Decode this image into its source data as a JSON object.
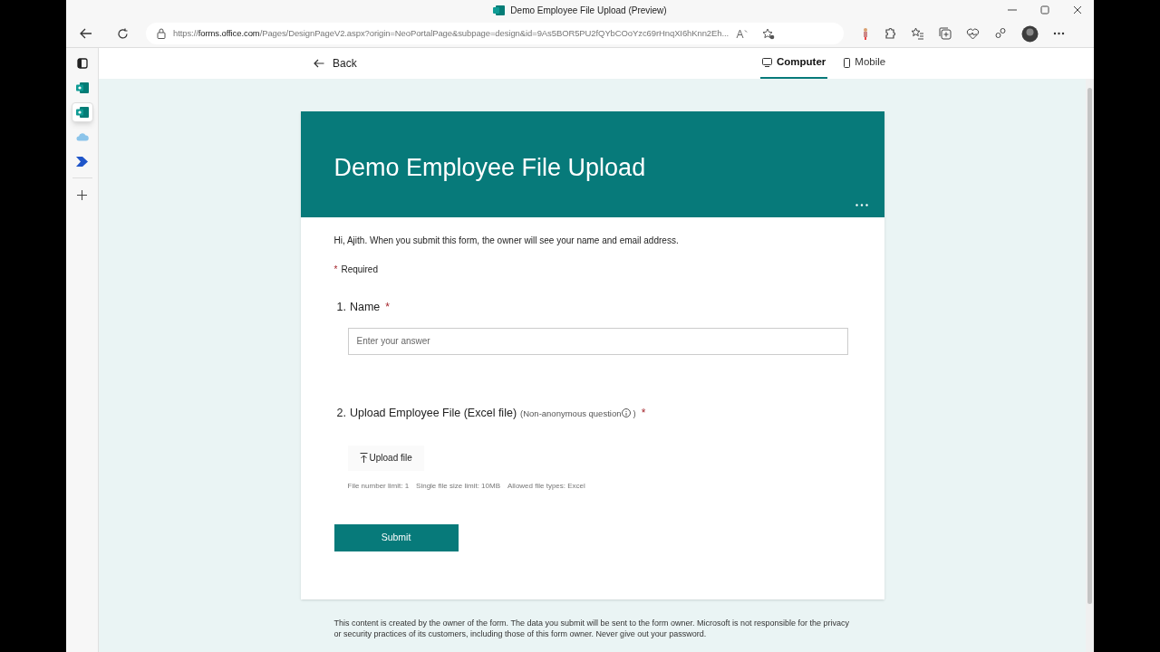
{
  "window": {
    "title": "Demo Employee File Upload (Preview)"
  },
  "address_bar": {
    "url_prefix": "https://",
    "url_host": "forms.office.com",
    "url_rest": "/Pages/DesignPageV2.aspx?origin=NeoPortalPage&subpage=design&id=9As5BOR5PU2fQYbCOoYzc69rHnqXI6hKnn2Eh..."
  },
  "sidebar": {
    "items": [
      {
        "kind": "tabs",
        "selected": false
      },
      {
        "kind": "forms",
        "selected": false
      },
      {
        "kind": "forms",
        "selected": true
      },
      {
        "kind": "cloud",
        "selected": false
      },
      {
        "kind": "automate",
        "selected": false
      },
      {
        "kind": "add",
        "selected": false
      }
    ]
  },
  "toolbar": {
    "back": "Back",
    "view_tabs": [
      {
        "label": "Computer",
        "kind": "computer",
        "selected": true
      },
      {
        "label": "Mobile",
        "kind": "mobile",
        "selected": false
      }
    ]
  },
  "form": {
    "title": "Demo Employee File Upload",
    "intro": "Hi, Ajith. When you submit this form, the owner will see your name and email address.",
    "required_mark": "*",
    "required_label": "Required",
    "questions": [
      {
        "kind": "text",
        "number": "1.",
        "title": "Name",
        "required": true,
        "placeholder": "Enter your answer"
      },
      {
        "kind": "file",
        "number": "2.",
        "title": "Upload Employee File (Excel file)",
        "required": true,
        "note": "(Non-anonymous question",
        "note_end": ")",
        "button": "Upload file",
        "limits": [
          "File number limit: 1",
          "Single file size limit: 10MB",
          "Allowed file types: Excel"
        ]
      }
    ],
    "submit": "Submit"
  },
  "disclaimer": "This content is created by the owner of the form. The data you submit will be sent to the form owner. Microsoft is not responsible for the privacy or security practices of its customers, including those of this form owner. Never give out your password."
}
